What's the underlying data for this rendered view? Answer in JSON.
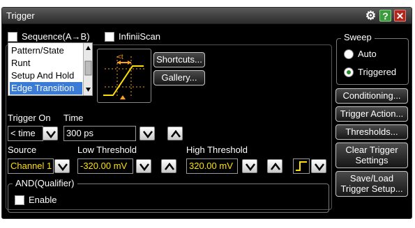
{
  "window": {
    "title": "Trigger"
  },
  "options": {
    "sequence_label": "Sequence(A→B)",
    "infiniiscan_label": "InfiniiScan"
  },
  "trigger_types": {
    "items": [
      "Pattern/State",
      "Runt",
      "Setup And Hold",
      "Edge Transition"
    ],
    "selected": "Edge Transition"
  },
  "preview": {
    "time_label": "<t"
  },
  "buttons": {
    "shortcuts": "Shortcuts...",
    "gallery": "Gallery...",
    "conditioning": "Conditioning...",
    "trigger_action": "Trigger Action...",
    "thresholds": "Thresholds...",
    "clear_trigger_line1": "Clear Trigger",
    "clear_trigger_line2": "Settings",
    "save_load_line1": "Save/Load",
    "save_load_line2": "Trigger Setup..."
  },
  "trigger_on": {
    "label": "Trigger On",
    "value": "< time"
  },
  "time": {
    "label": "Time",
    "value": "300 ps"
  },
  "source": {
    "label": "Source",
    "value": "Channel 1"
  },
  "low_threshold": {
    "label": "Low Threshold",
    "value": "-320.00 mV"
  },
  "high_threshold": {
    "label": "High Threshold",
    "value": "320.00 mV"
  },
  "sweep": {
    "label": "Sweep",
    "options": [
      "Auto",
      "Triggered"
    ],
    "selected": "Triggered"
  },
  "qualifier": {
    "label": "AND(Qualifier)",
    "enable_label": "Enable"
  },
  "colors": {
    "channel": "#ffe000",
    "accent_green": "#2c8a2c",
    "selection": "#3a7bd5"
  }
}
